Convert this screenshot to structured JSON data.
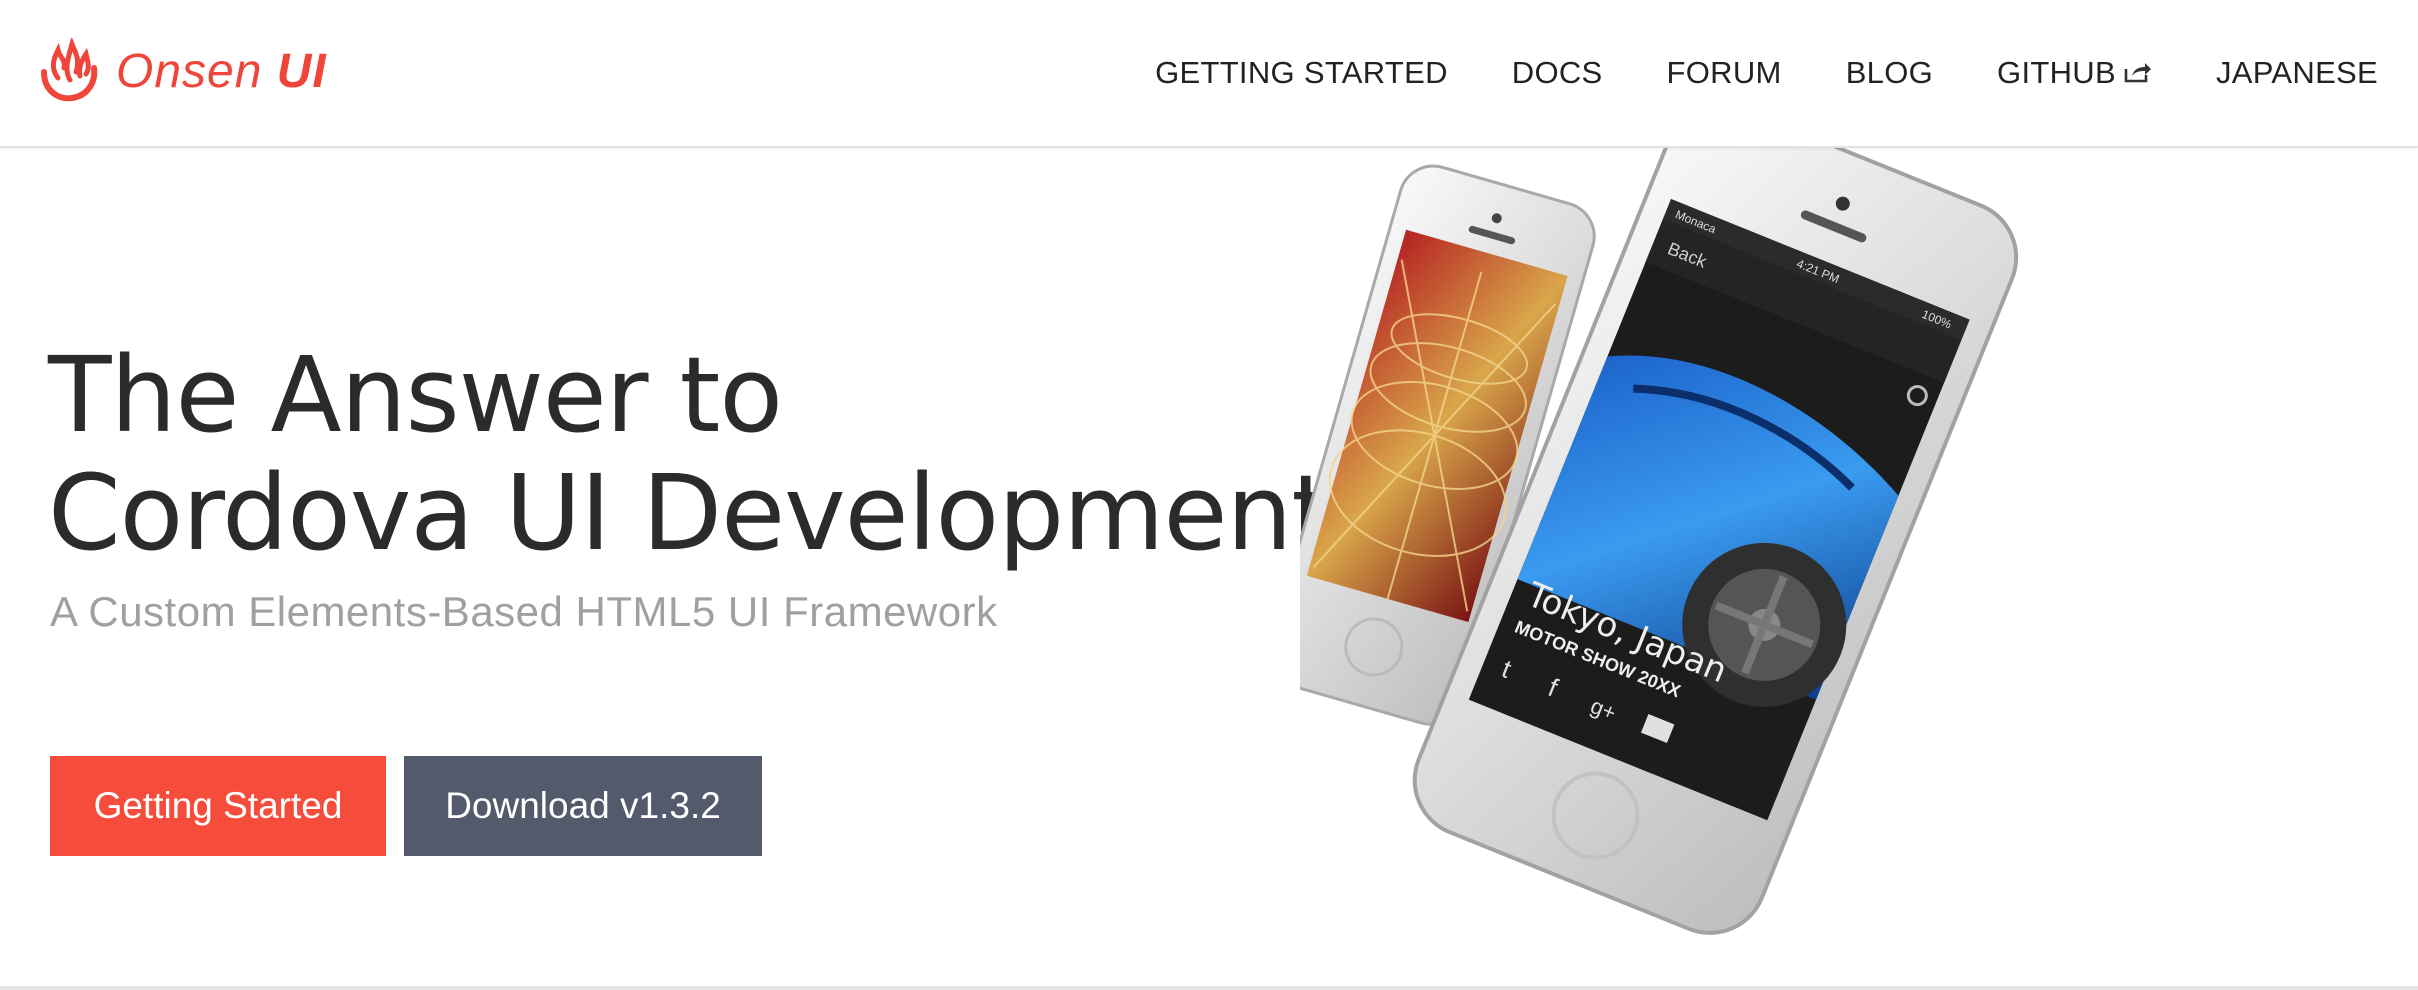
{
  "brand": {
    "name": "Onsen",
    "name_bold": "UI",
    "color": "#f0453a"
  },
  "nav": {
    "items": [
      {
        "label": "GETTING STARTED"
      },
      {
        "label": "DOCS"
      },
      {
        "label": "FORUM"
      },
      {
        "label": "BLOG"
      },
      {
        "label": "GITHUB",
        "icon": "external-link-icon"
      },
      {
        "label": "JAPANESE"
      }
    ]
  },
  "hero": {
    "title_line1": "The Answer to",
    "title_line2": "Cordova UI Development",
    "subtitle": "A Custom Elements-Based HTML5 UI Framework",
    "primary_button": "Getting Started",
    "secondary_button": "Download v1.3.2",
    "primary_color": "#f54c3c",
    "secondary_color": "#525a6b"
  },
  "phone_screen": {
    "status_carrier": "Monaca",
    "status_time": "4:21 PM",
    "status_battery": "100%",
    "back_label": "Back",
    "caption_city": "Tokyo, Japan",
    "caption_event": "MOTOR SHOW 20XX"
  }
}
